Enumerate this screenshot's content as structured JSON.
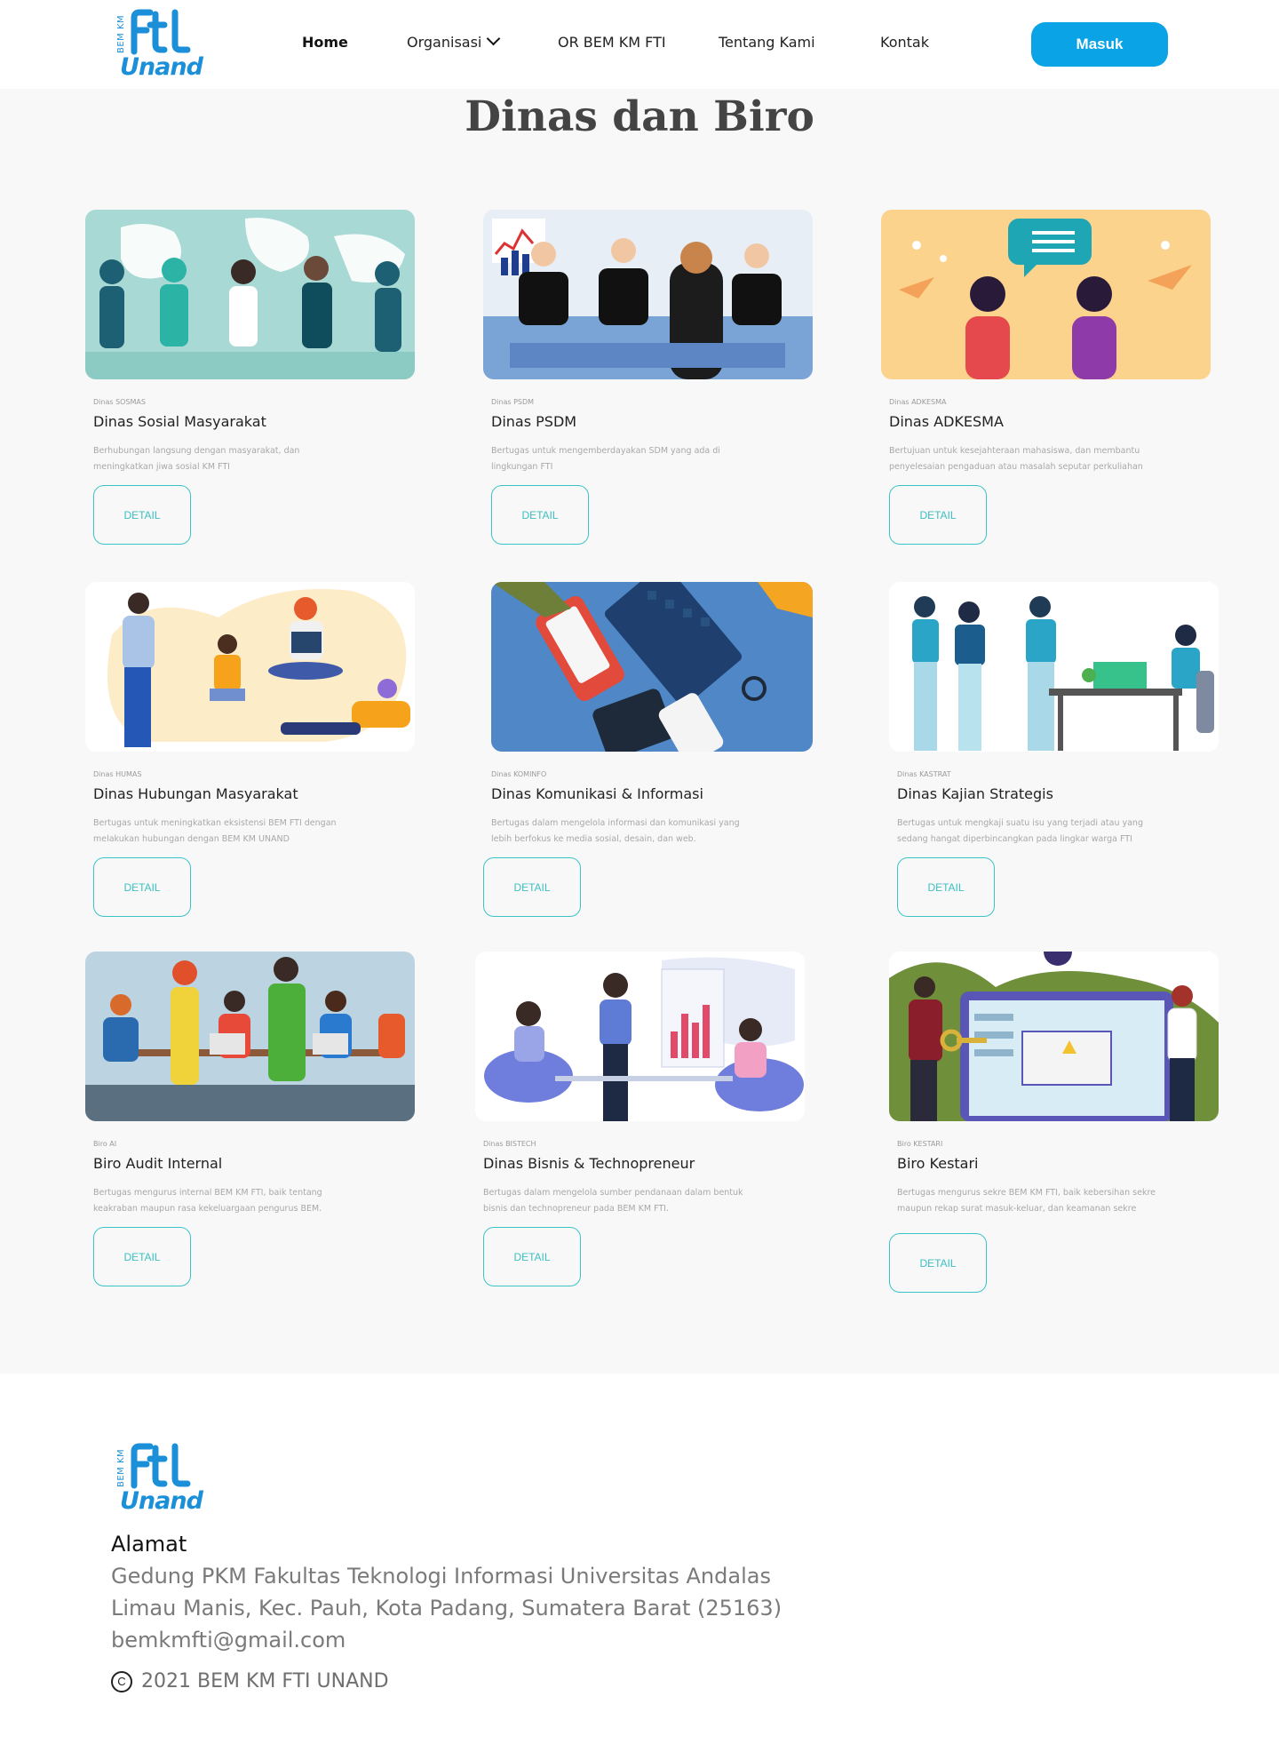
{
  "brand": {
    "side_text": "BEM KM",
    "logo_text": "FTI",
    "word": "Unand",
    "color": "#1b8fd8"
  },
  "nav": {
    "items": [
      {
        "label": "Home"
      },
      {
        "label": "Organisasi"
      },
      {
        "label": "OR BEM KM FTI"
      },
      {
        "label": "Tentang Kami"
      },
      {
        "label": "Kontak"
      }
    ],
    "login": "Masuk",
    "accent": "#0aa3e6"
  },
  "page": {
    "title": "Dinas dan Biro",
    "detail_label": "DETAIL",
    "cards": [
      {
        "tag": "Dinas SOSMAS",
        "title": "Dinas Sosial Masyarakat",
        "desc": "Berhubungan langsung dengan masyarakat, dan meningkatkan jiwa sosial KM FTI",
        "illustration": "people-holding-hands-world-map"
      },
      {
        "tag": "Dinas PSDM",
        "title": "Dinas PSDM",
        "desc": "Bertugas untuk mengemberdayakan SDM yang ada di lingkungan FTI",
        "illustration": "job-interview-panel"
      },
      {
        "tag": "Dinas ADKESMA",
        "title": "Dinas ADKESMA",
        "desc": "Bertujuan untuk kesejahteraan mahasiswa, dan membantu penyelesaian pengaduan atau masalah seputar perkuliahan",
        "illustration": "two-women-chat-bubble"
      },
      {
        "tag": "Dinas HUMAS",
        "title": "Dinas Hubungan Masyarakat",
        "desc": "Bertugas untuk meningkatkan eksistensi BEM FTI dengan melakukan hubungan dengan BEM KM UNAND",
        "illustration": "people-reading-books"
      },
      {
        "tag": "Dinas KOMINFO",
        "title": "Dinas Komunikasi & Informasi",
        "desc": "Bertugas dalam mengelola informasi dan komunikasi yang lebih berfokus ke media sosial, desain, dan web.",
        "illustration": "hands-devices-keyboard"
      },
      {
        "tag": "Dinas KASTRAT",
        "title": "Dinas Kajian Strategis",
        "desc": "Bertugas untuk mengkaji suatu isu yang terjadi atau yang sedang hangat diperbincangkan pada lingkar warga FTI",
        "illustration": "team-standing-desk"
      },
      {
        "tag": "Biro AI",
        "title": "Biro Audit Internal",
        "desc": "Bertugas mengurus internal BEM KM FTI, baik tentang keakraban maupun rasa kekeluargaan pengurus BEM.",
        "illustration": "team-working-laptops"
      },
      {
        "tag": "Dinas BISTECH",
        "title": "Dinas Bisnis & Technopreneur",
        "desc": "Bertugas dalam mengelola sumber pendanaan dalam bentuk bisnis dan technopreneur pada BEM KM FTI.",
        "illustration": "business-presentation-chart"
      },
      {
        "tag": "Biro KESTARI",
        "title": "Biro Kestari",
        "desc": "Bertugas mengurus sekre BEM KM FTI, baik kebersihan sekre maupun rekap surat masuk-keluar, dan keamanan sekre",
        "illustration": "key-dashboard-screen"
      }
    ]
  },
  "footer": {
    "heading": "Alamat",
    "address_line1": "Gedung PKM Fakultas Teknologi Informasi Universitas Andalas",
    "address_line2": "Limau Manis, Kec. Pauh, Kota Padang, Sumatera Barat (25163)",
    "email": "bemkmfti@gmail.com",
    "copyright": "2021 BEM KM FTI UNAND"
  }
}
